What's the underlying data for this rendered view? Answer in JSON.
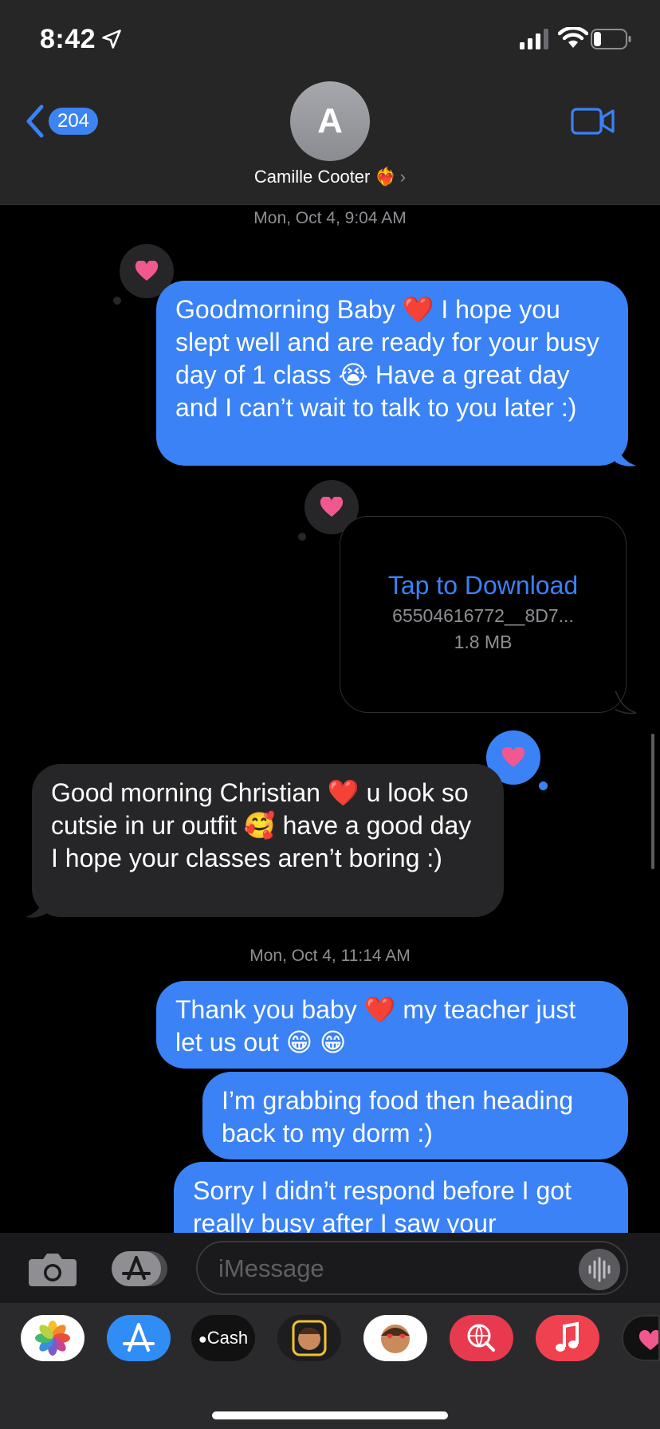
{
  "status": {
    "time": "8:42"
  },
  "nav": {
    "back_count": "204"
  },
  "contact": {
    "initial": "A",
    "name": "Camille Cooter",
    "emoji": "❤️‍🔥"
  },
  "messages": {
    "timestamp_1": "Mon, Oct 4, 9:04 AM",
    "msg_1": "Goodmorning Baby ❤️ I hope you slept well and are ready for your busy day of 1 class 😭 Have a great day and I can’t wait to talk to you later :)",
    "attachment": {
      "link": "Tap to Download",
      "filename": "65504616772__8D7...",
      "size": "1.8 MB"
    },
    "msg_2": "Good morning Christian ❤️ u look so cutsie in ur outfit 🥰 have a good day I hope your classes aren’t boring :)",
    "timestamp_2": "Mon, Oct 4, 11:14 AM",
    "msg_3": "Thank you baby ❤️ my teacher just let us out 😁 😁",
    "msg_4": "I’m grabbing food then heading back to my dorm :)",
    "msg_5": "Sorry I didn’t respond before I got really busy after I saw your"
  },
  "compose": {
    "placeholder": "iMessage"
  },
  "apps": [
    {
      "icon": "photos-icon"
    },
    {
      "icon": "app-store-icon"
    },
    {
      "icon": "apple-cash-icon",
      "label": "Cash"
    },
    {
      "icon": "memoji-icon"
    },
    {
      "icon": "memoji-stickers-icon"
    },
    {
      "icon": "web-search-icon"
    },
    {
      "icon": "music-icon"
    },
    {
      "icon": "digital-touch-icon"
    }
  ],
  "colors": {
    "accent": "#3a82f6",
    "sent_bubble": "#3a82f6",
    "received_bubble": "#262628",
    "heart": "#f0588f"
  }
}
